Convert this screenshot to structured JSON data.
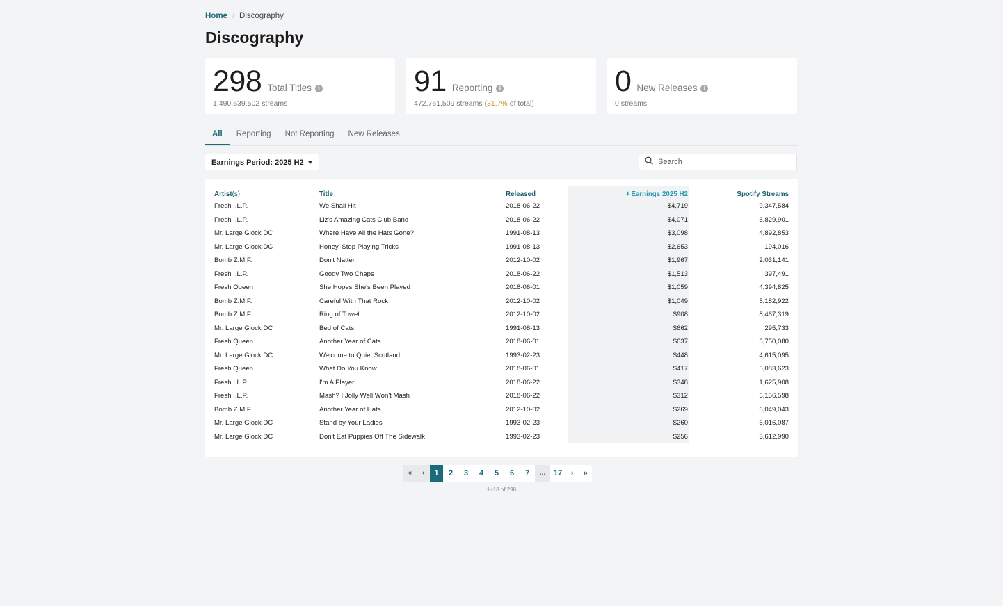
{
  "breadcrumb": {
    "home": "Home",
    "separator": "/",
    "current": "Discography"
  },
  "page_title": "Discography",
  "cards": [
    {
      "number": "298",
      "label": "Total Titles",
      "sub_prefix": "1,490,639,502 streams",
      "sub_pct": "",
      "sub_suffix": ""
    },
    {
      "number": "91",
      "label": "Reporting",
      "sub_prefix": "472,761,509 streams (",
      "sub_pct": "31.7%",
      "sub_suffix": " of total)"
    },
    {
      "number": "0",
      "label": "New Releases",
      "sub_prefix": "0 streams",
      "sub_pct": "",
      "sub_suffix": ""
    }
  ],
  "info_glyph": "i",
  "tabs": [
    "All",
    "Reporting",
    "Not Reporting",
    "New Releases"
  ],
  "period_label": "Earnings Period: 2025 H2",
  "search_placeholder": "Search",
  "table": {
    "headers": {
      "artist_link": "Artist",
      "artist_suffix": "(s)",
      "title": "Title",
      "released": "Released",
      "earnings": "Earnings 2025 H2",
      "streams": "Spotify Streams"
    },
    "rows": [
      [
        "Fresh I.L.P.",
        "We Shall Hit",
        "2018-06-22",
        "$4,719",
        "9,347,584"
      ],
      [
        "Fresh I.L.P.",
        "Liz's Amazing Cats Club Band",
        "2018-06-22",
        "$4,071",
        "6,829,901"
      ],
      [
        "Mr. Large Glock DC",
        "Where Have All the Hats Gone?",
        "1991-08-13",
        "$3,098",
        "4,892,853"
      ],
      [
        "Mr. Large Glock DC",
        "Honey, Stop Playing Tricks",
        "1991-08-13",
        "$2,653",
        "194,016"
      ],
      [
        "Bomb Z.M.F.",
        "Don't Natter",
        "2012-10-02",
        "$1,967",
        "2,031,141"
      ],
      [
        "Fresh I.L.P.",
        "Goody Two Chaps",
        "2018-06-22",
        "$1,513",
        "397,491"
      ],
      [
        "Fresh Queen",
        "She Hopes She's Been Played",
        "2018-06-01",
        "$1,059",
        "4,394,825"
      ],
      [
        "Bomb Z.M.F.",
        "Careful With That Rock",
        "2012-10-02",
        "$1,049",
        "5,182,922"
      ],
      [
        "Bomb Z.M.F.",
        "Ring of Towel",
        "2012-10-02",
        "$908",
        "8,467,319"
      ],
      [
        "Mr. Large Glock DC",
        "Bed of Cats",
        "1991-08-13",
        "$662",
        "295,733"
      ],
      [
        "Fresh Queen",
        "Another Year of Cats",
        "2018-06-01",
        "$637",
        "6,750,080"
      ],
      [
        "Mr. Large Glock DC",
        "Welcome to Quiet Scotland",
        "1993-02-23",
        "$448",
        "4,615,095"
      ],
      [
        "Fresh Queen",
        "What Do You Know",
        "2018-06-01",
        "$417",
        "5,083,623"
      ],
      [
        "Fresh I.L.P.",
        "I'm A Player",
        "2018-06-22",
        "$348",
        "1,625,908"
      ],
      [
        "Fresh I.L.P.",
        "Mash? I Jolly Well Won't Mash",
        "2018-06-22",
        "$312",
        "6,156,598"
      ],
      [
        "Bomb Z.M.F.",
        "Another Year of Hats",
        "2012-10-02",
        "$269",
        "6,049,043"
      ],
      [
        "Mr. Large Glock DC",
        "Stand by Your Ladies",
        "1993-02-23",
        "$260",
        "6,016,087"
      ],
      [
        "Mr. Large Glock DC",
        "Don't Eat Puppies Off The Sidewalk",
        "1993-02-23",
        "$256",
        "3,612,990"
      ]
    ]
  },
  "pagination": {
    "first": "«",
    "prev": "‹",
    "next": "›",
    "last": "»",
    "pages": [
      "1",
      "2",
      "3",
      "4",
      "5",
      "6",
      "7"
    ],
    "ellipsis": "...",
    "last_page": "17",
    "current": "1",
    "info": "1–18 of 298"
  },
  "colors": {
    "accent": "#1b6b7a",
    "sort_accent": "#2a9bb1",
    "percent": "#c9932b"
  }
}
